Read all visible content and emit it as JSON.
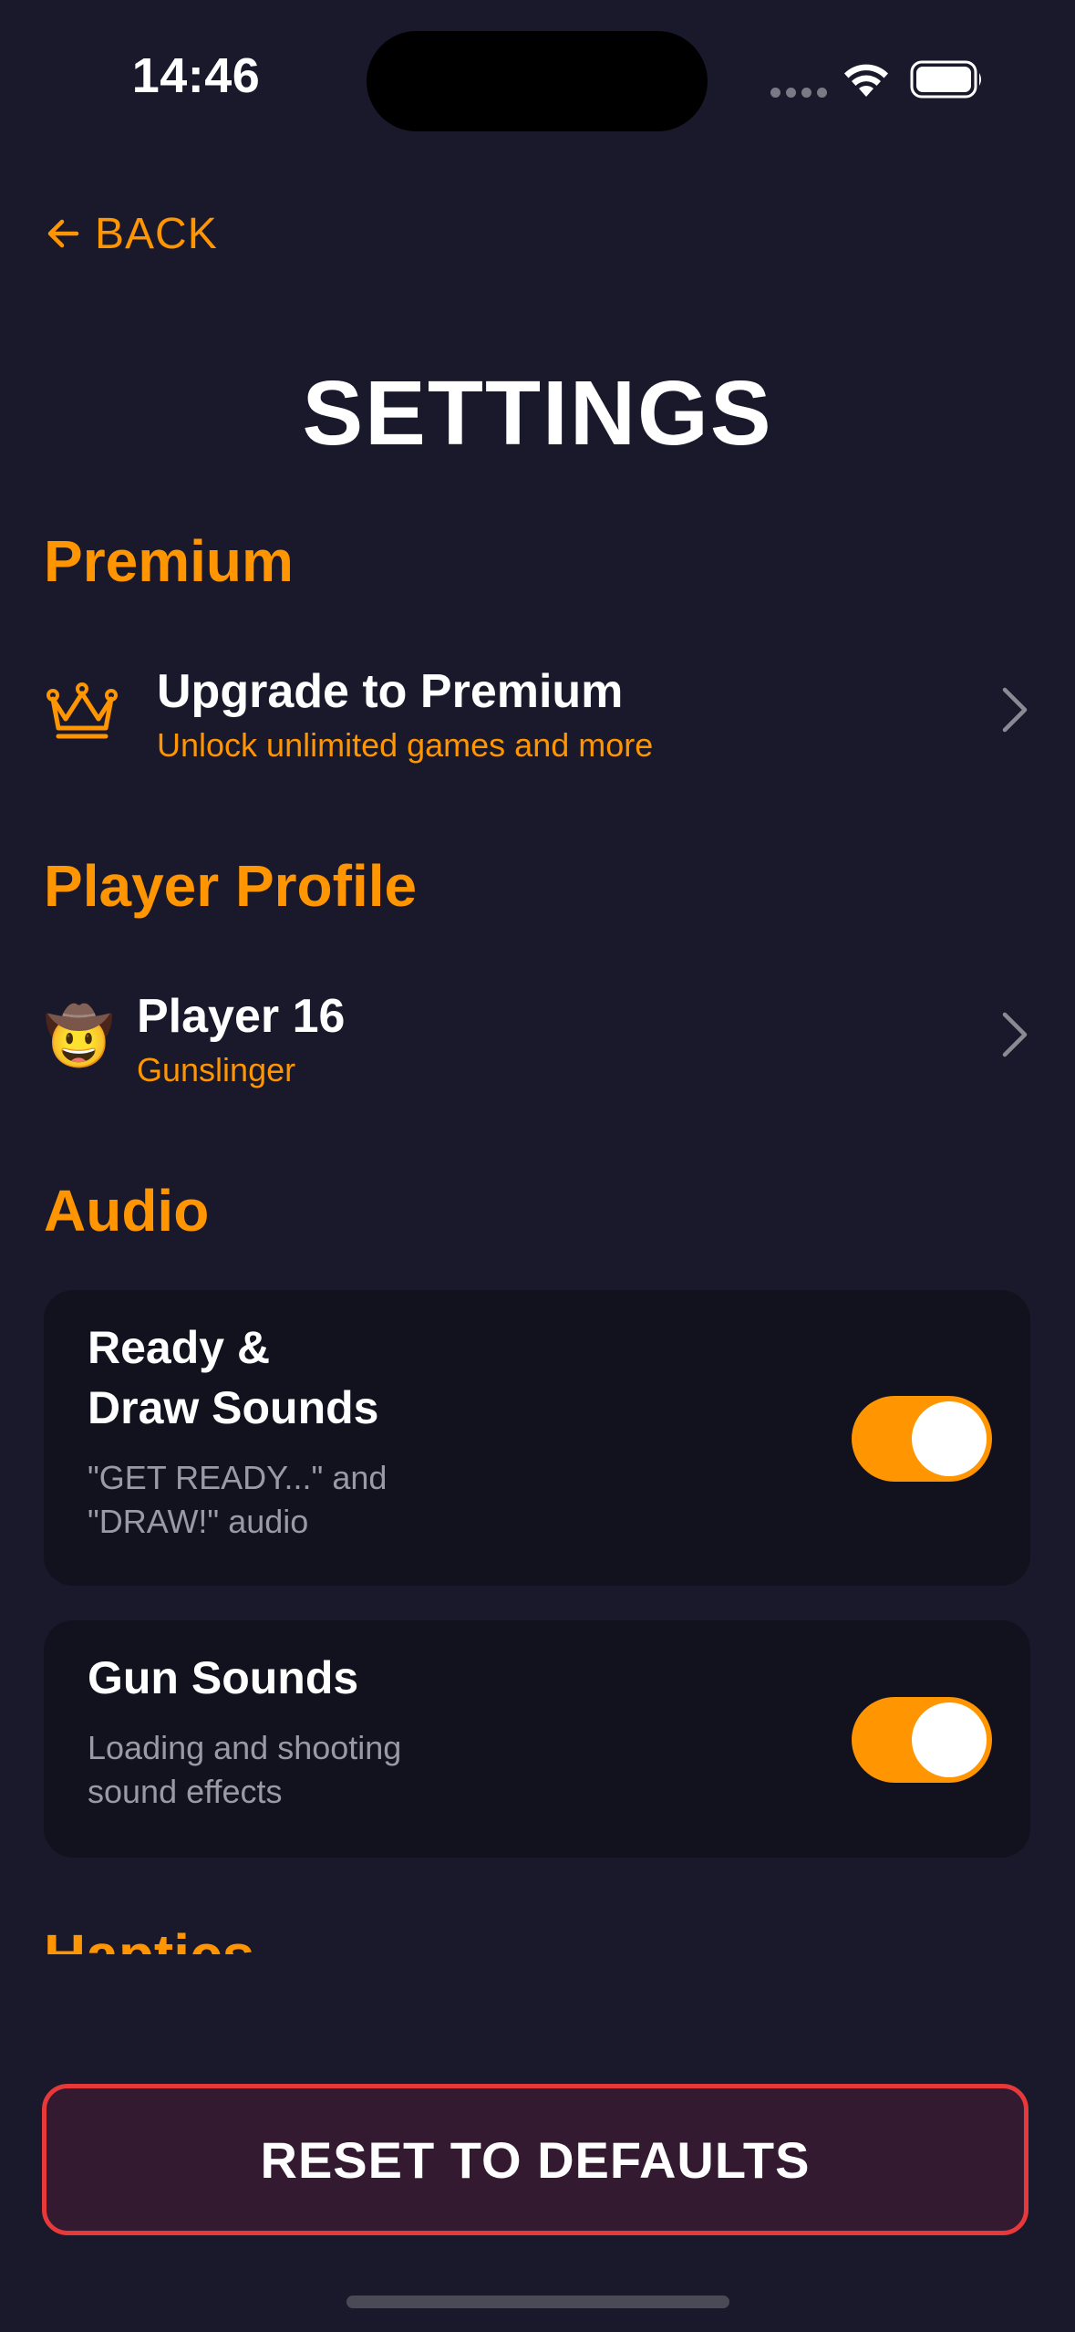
{
  "status_bar": {
    "time": "14:46"
  },
  "nav": {
    "back_label": "BACK"
  },
  "page": {
    "title": "SETTINGS"
  },
  "sections": {
    "premium": {
      "heading": "Premium",
      "row_title": "Upgrade to Premium",
      "row_subtitle": "Unlock unlimited games and more",
      "icon": "crown-icon"
    },
    "profile": {
      "heading": "Player Profile",
      "player_name": "Player 16",
      "player_rank": "Gunslinger",
      "avatar": "🤠"
    },
    "audio": {
      "heading": "Audio",
      "items": [
        {
          "title_line1": "Ready &",
          "title_line2": "Draw Sounds",
          "desc_line1": "\"GET READY...\" and",
          "desc_line2": "\"DRAW!\" audio",
          "enabled": true
        },
        {
          "title_line1": "Gun Sounds",
          "desc_line1": "Loading and shooting",
          "desc_line2": "sound effects",
          "enabled": true
        }
      ]
    },
    "haptics": {
      "heading": "Haptics"
    }
  },
  "footer": {
    "reset_label": "RESET TO DEFAULTS"
  },
  "colors": {
    "background": "#19192b",
    "accent": "#ff9500",
    "card": "#12121f",
    "danger": "#e8393a"
  }
}
